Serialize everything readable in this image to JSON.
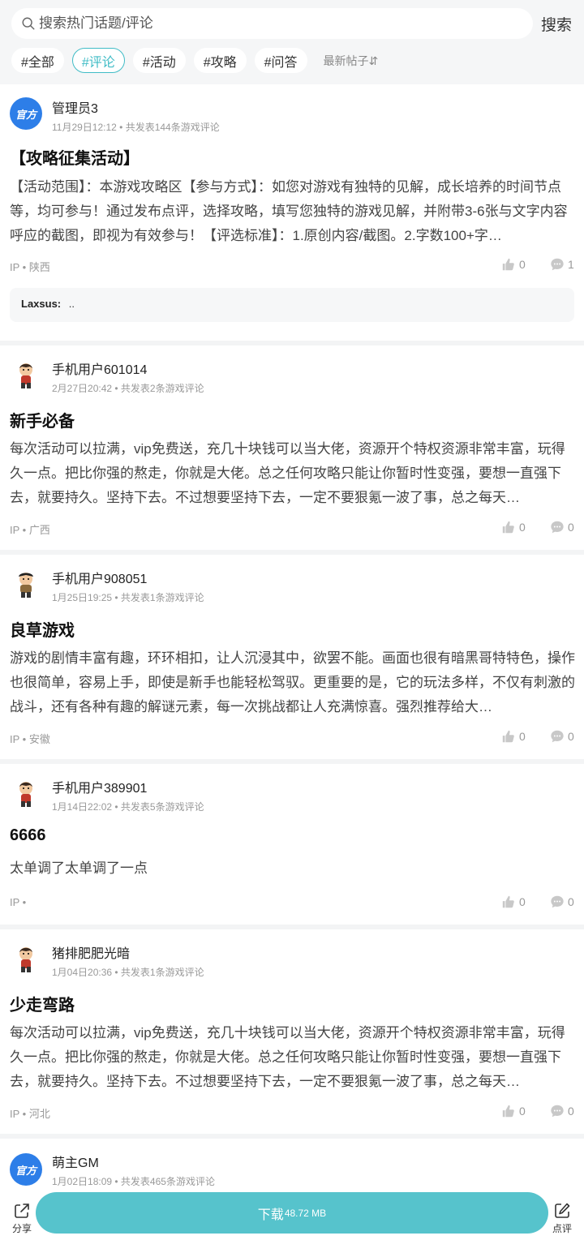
{
  "search": {
    "placeholder": "搜索热门话题/评论",
    "button_label": "搜索"
  },
  "tags": [
    "#全部",
    "#评论",
    "#活动",
    "#攻略",
    "#问答"
  ],
  "active_tag": "#评论",
  "sort_label": "最新帖子⇵",
  "posts": [
    {
      "avatar": "官方",
      "username": "管理员3",
      "meta": "11月29日12:12 • 共发表144条游戏评论",
      "title": "【攻略征集活动】",
      "body": "【活动范围】：本游戏攻略区【参与方式】：如您对游戏有独特的见解，成长培养的时间节点等，均可参与！通过发布点评，选择攻略，填写您独特的游戏见解，并附带3-6张与文字内容呼应的截图，即视为有效参与！【评选标准】：1.原创内容/截图。2.字数100+字…",
      "ip": "IP • 陕西",
      "likes": "0",
      "comments": "1",
      "reply_user": "Laxsus:",
      "reply_text": ".."
    },
    {
      "username": "手机用户601014",
      "meta": "2月27日20:42 • 共发表2条游戏评论",
      "title": "新手必备",
      "body": "每次活动可以拉满，vip免费送，充几十块钱可以当大佬，资源开个特权资源非常丰富，玩得久一点。把比你强的熬走，你就是大佬。总之任何攻略只能让你暂时性变强，要想一直强下去，就要持久。坚持下去。不过想要坚持下去，一定不要狠氪一波了事，总之每天…",
      "ip": "IP • 广西",
      "likes": "0",
      "comments": "0"
    },
    {
      "username": "手机用户908051",
      "meta": "1月25日19:25 • 共发表1条游戏评论",
      "title": "良草游戏",
      "body": "游戏的剧情丰富有趣，环环相扣，让人沉浸其中，欲罢不能。画面也很有暗黑哥特特色，操作也很简单，容易上手，即使是新手也能轻松驾驭。更重要的是，它的玩法多样，不仅有刺激的战斗，还有各种有趣的解谜元素，每一次挑战都让人充满惊喜。强烈推荐给大…",
      "ip": "IP • 安徽",
      "likes": "0",
      "comments": "0"
    },
    {
      "username": "手机用户389901",
      "meta": "1月14日22:02 • 共发表5条游戏评论",
      "title": "6666",
      "body": "太单调了太单调了一点",
      "ip": "IP •",
      "likes": "0",
      "comments": "0"
    },
    {
      "username": "猪排肥肥光暗",
      "meta": "1月04日20:36 • 共发表1条游戏评论",
      "title": "少走弯路",
      "body": "每次活动可以拉满，vip免费送，充几十块钱可以当大佬，资源开个特权资源非常丰富，玩得久一点。把比你强的熬走，你就是大佬。总之任何攻略只能让你暂时性变强，要想一直强下去，就要持久。坚持下去。不过想要坚持下去，一定不要狠氪一波了事，总之每天…",
      "ip": "IP • 河北",
      "likes": "0",
      "comments": "0"
    },
    {
      "avatar": "官方",
      "username": "萌主GM",
      "meta": "1月02日18:09 • 共发表465条游戏评论"
    }
  ],
  "bottom": {
    "share_label": "分享",
    "download_label": "下载",
    "download_size": "48.72 MB",
    "review_label": "点评"
  },
  "colors": {
    "accent": "#40bcc6",
    "download_bg": "#56c3cc",
    "official_avatar": "#2d7ee8"
  }
}
